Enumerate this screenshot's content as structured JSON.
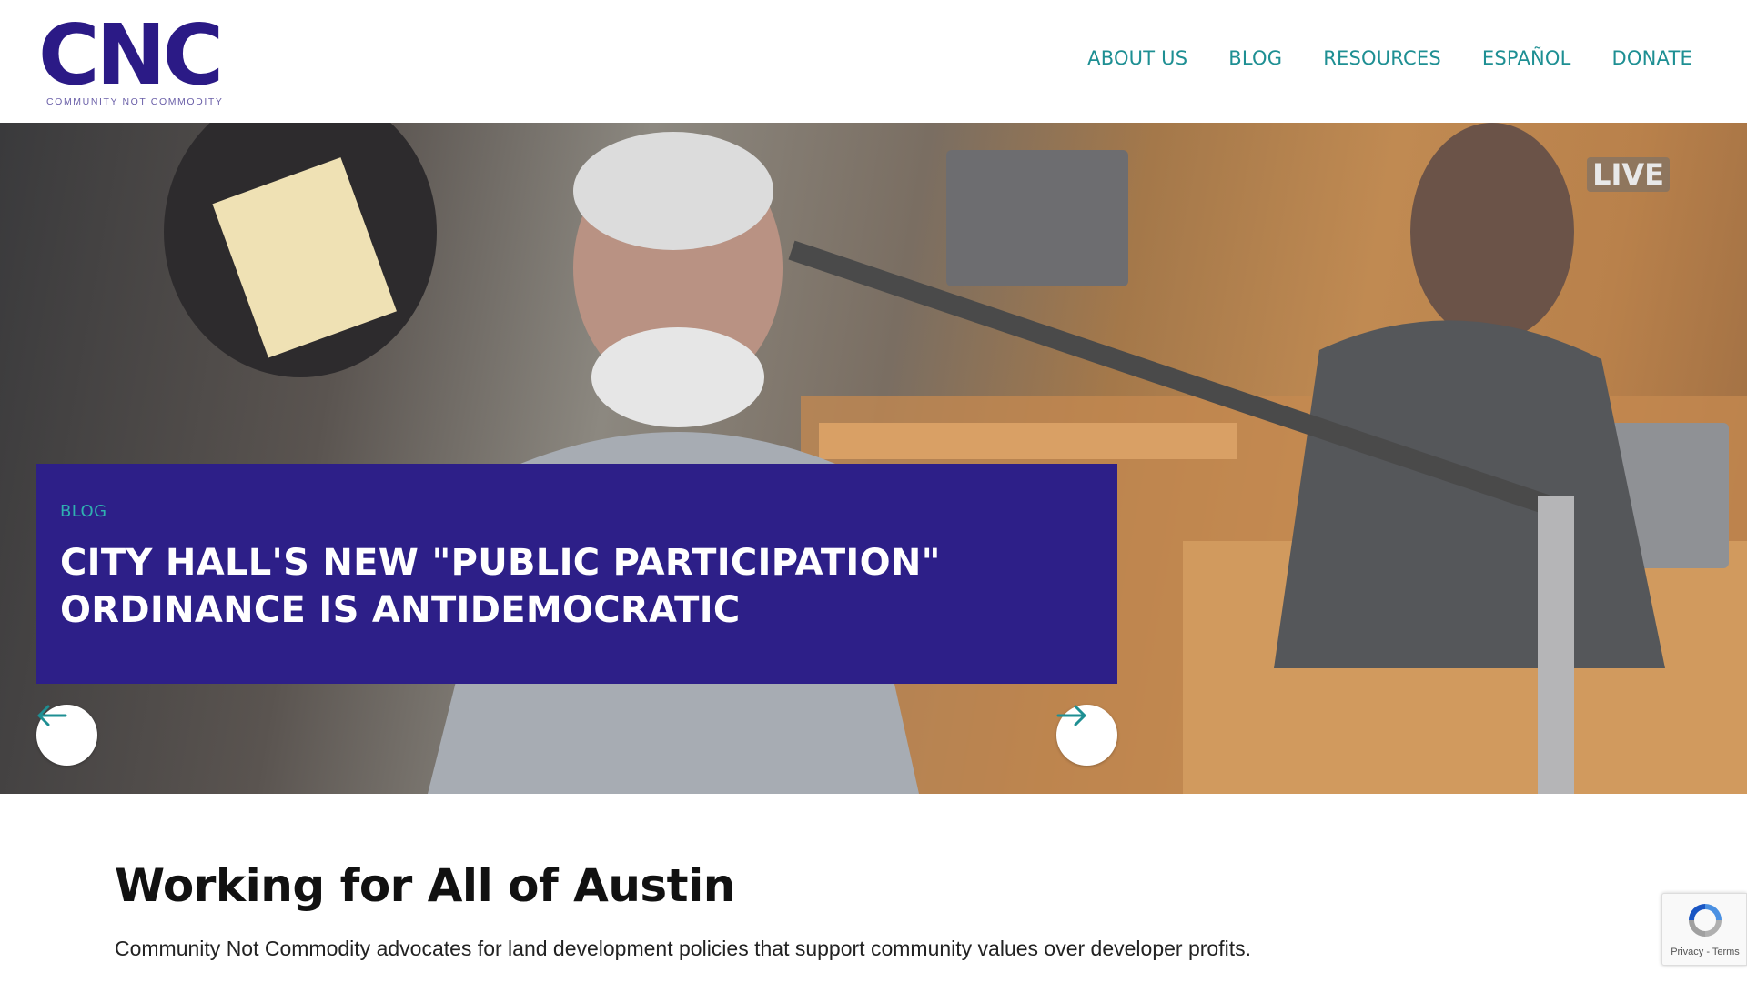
{
  "brand": {
    "logo_mark": "CNC",
    "logo_tagline": "COMMUNITY NOT COMMODITY",
    "colors": {
      "primary": "#2b1a86",
      "accent_teal": "#1e8f93",
      "card": "#2d1f88"
    }
  },
  "nav": {
    "items": [
      {
        "label": "ABOUT US"
      },
      {
        "label": "BLOG"
      },
      {
        "label": "RESOURCES"
      },
      {
        "label": "ESPAÑOL"
      },
      {
        "label": "DONATE"
      }
    ]
  },
  "hero": {
    "overlay_badge": "LIVE",
    "slide": {
      "category": "BLOG",
      "title": "CITY HALL'S NEW \"PUBLIC PARTICIPATION\" ORDINANCE IS ANTIDEMOCRATIC"
    },
    "prev_icon": "arrow-left-icon",
    "next_icon": "arrow-right-icon"
  },
  "main": {
    "title": "Working for All of Austin",
    "subtitle": "Community Not Commodity advocates for land development policies that support community values over developer profits."
  },
  "recaptcha": {
    "icon": "recaptcha-icon",
    "links": "Privacy - Terms"
  }
}
